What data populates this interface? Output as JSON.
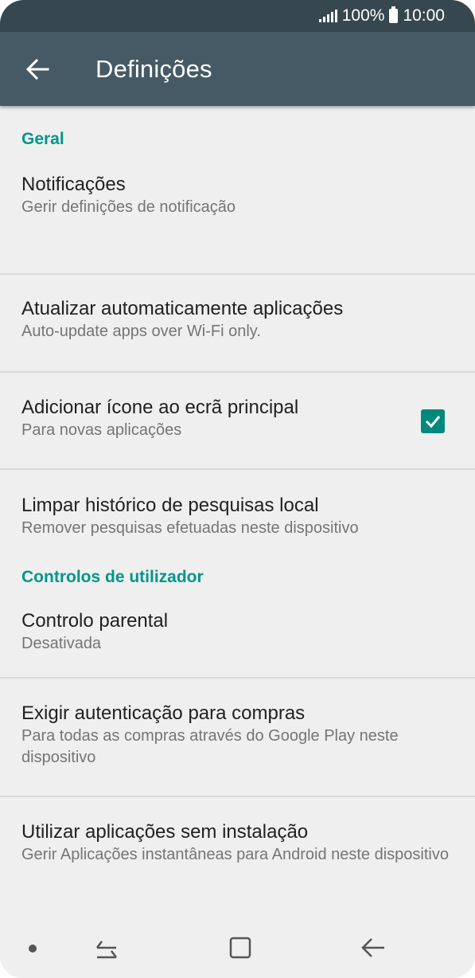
{
  "status_bar": {
    "battery_text": "100%",
    "time": "10:00"
  },
  "app_bar": {
    "title": "Definições"
  },
  "sections": [
    {
      "header": "Geral",
      "items": [
        {
          "title": "Notificações",
          "subtitle": "Gerir definições de notificação"
        },
        {
          "title": "Atualizar automaticamente aplicações",
          "subtitle": "Auto-update apps over Wi-Fi only."
        },
        {
          "title": "Adicionar ícone ao ecrã principal",
          "subtitle": "Para novas aplicações",
          "checked": true
        },
        {
          "title": "Limpar histórico de pesquisas local",
          "subtitle": "Remover pesquisas efetuadas neste dispositivo"
        }
      ]
    },
    {
      "header": "Controlos de utilizador",
      "items": [
        {
          "title": "Controlo parental",
          "subtitle": "Desativada"
        },
        {
          "title": "Exigir autenticação para compras",
          "subtitle": "Para todas as compras através do Google Play neste dispositivo"
        },
        {
          "title": "Utilizar aplicações sem instalação",
          "subtitle": "Gerir Aplicações instantâneas para Android neste dispositivo"
        }
      ]
    }
  ],
  "colors": {
    "app_bar": "#455a64",
    "status_bar": "#37474f",
    "accent": "#009688"
  },
  "icons": [
    "signal-icon",
    "battery-icon",
    "back-arrow-icon",
    "checkbox-checked-icon",
    "nav-dot-icon",
    "recent-apps-icon",
    "home-icon",
    "nav-back-icon"
  ]
}
